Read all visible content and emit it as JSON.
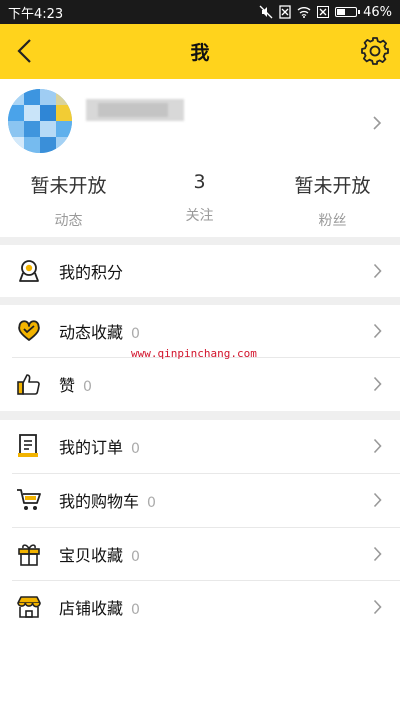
{
  "status_bar": {
    "time": "下午4:23",
    "battery": "46%",
    "battery_level": 0.46
  },
  "header": {
    "title": "我"
  },
  "stats": [
    {
      "value": "暂未开放",
      "label": "动态"
    },
    {
      "value": "3",
      "label": "关注"
    },
    {
      "value": "暂未开放",
      "label": "粉丝"
    }
  ],
  "menu": {
    "points": {
      "label": "我的积分"
    },
    "fav_posts": {
      "label": "动态收藏",
      "count": "0"
    },
    "likes": {
      "label": "赞",
      "count": "0"
    },
    "orders": {
      "label": "我的订单",
      "count": "0"
    },
    "cart": {
      "label": "我的购物车",
      "count": "0"
    },
    "fav_items": {
      "label": "宝贝收藏",
      "count": "0"
    },
    "fav_shops": {
      "label": "店铺收藏",
      "count": "0"
    }
  },
  "watermark": "www.qinpinchang.com",
  "colors": {
    "accent": "#ffd31c",
    "icon_yellow": "#f2b300"
  }
}
